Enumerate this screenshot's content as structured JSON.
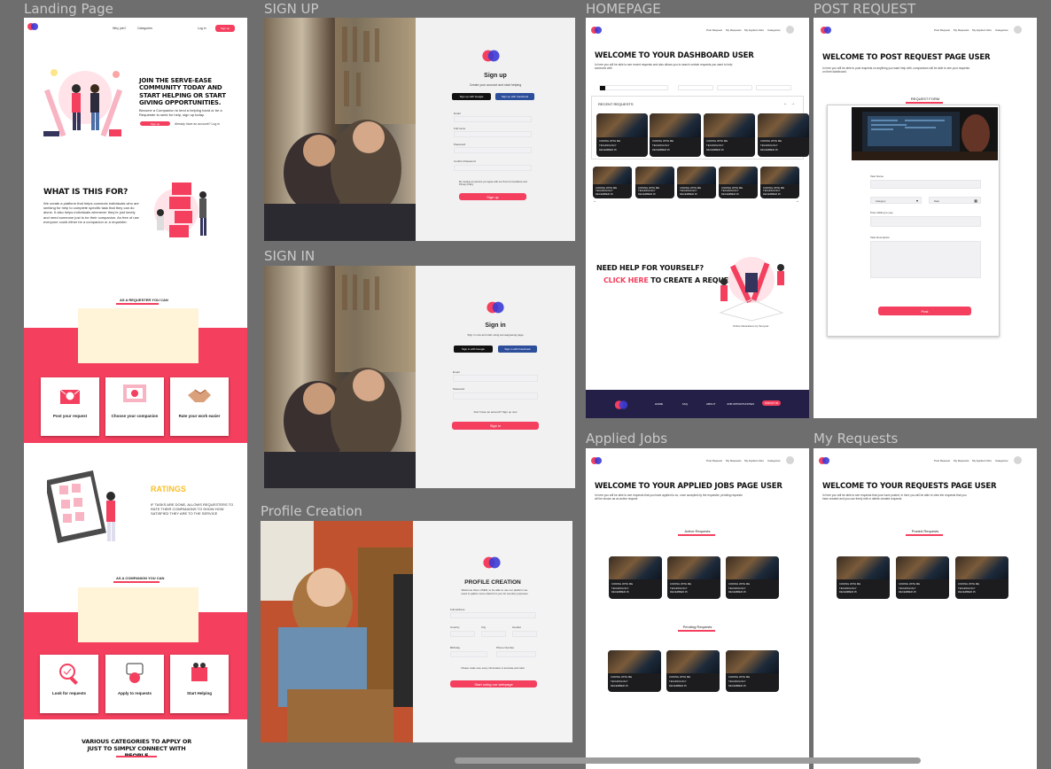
{
  "frames": {
    "landing": "Landing Page",
    "signup": "SIGN UP",
    "signin": "SIGN IN",
    "profile": "Profile Creation",
    "homepage": "HOMEPAGE",
    "post": "POST REQUEST",
    "applied": "Applied Jobs",
    "myreq": "My Requests"
  },
  "landing": {
    "nav": [
      "Why join?",
      "Categories",
      "Log in",
      "Sign up"
    ],
    "hero_title": "JOIN THE SERVE-EASE COMMUNITY TODAY AND START HELPING OR START GIVING OPPORTUNITIES.",
    "hero_sub": "Become a Companion to lend a helping hand or be a Requester to seek for help, sign up today.",
    "hero_btn": "Sign up",
    "hero_login": "Already have an account? Log in",
    "what_title": "WHAT IS THIS FOR?",
    "what_body": "We create a platform that helps connects individuals who are seeking for help to complete specific task that they can do alone. It also helps individuals whenever they're just lonely and need someone just to be their companion. As free of use everyone could either be a companion or a requester.",
    "req_heading": "AS A REQUESTER YOU CAN",
    "req_cards": [
      "Post your request",
      "Choose your companion",
      "Rate your work easier"
    ],
    "ratings_title": "RATINGS",
    "ratings_body": "IF TASKS ARE DONE, ALLOWS REQUESTERS TO RATE THEIR COMPANIONS TO SHOW HOW SATISFIED THEY ARE TO THE SERVICE",
    "comp_heading": "AS A COMPANION YOU CAN",
    "comp_cards": [
      "Look for requests",
      "Apply to requests",
      "Start Helping"
    ],
    "categories_title": "VARIOUS CATEGORIES TO APPLY OR JUST TO SIMPLY CONNECT WITH PEOPLE"
  },
  "signup": {
    "title": "Sign up",
    "sub": "Create your account and start helping",
    "google": "Sign up with Google",
    "facebook": "Sign up with Facebook",
    "fields": [
      "Email",
      "Full name",
      "Password",
      "Confirm Password"
    ],
    "terms": "By creating an account you agree with our Terms & Conditions and Privacy Policy",
    "btn": "Sign up"
  },
  "signin": {
    "title": "Sign in",
    "sub": "Sign in now and start using serveagreeing page",
    "google": "Sign in with Google",
    "facebook": "Sign in with Facebook",
    "fields": [
      "Email",
      "Password"
    ],
    "register": "Don't have an account? Sign up now",
    "btn": "Sign in"
  },
  "profile": {
    "title": "PROFILE CREATION",
    "sub": "Welcome there USER, to be able to use our platform we need to gather some data from you for security purposes",
    "fields": [
      "Full address",
      "Country",
      "City",
      "Gender",
      "Birthday",
      "Phone Number"
    ],
    "note": "Please make sure every information is accurate and valid",
    "btn": "Start using our webpage"
  },
  "home": {
    "nav": [
      "Post Request",
      "My Requests",
      "My Applied Jobs",
      "Categories"
    ],
    "title": "WELCOME TO YOUR DASHBOARD USER",
    "sub": "In here you will be able to see recent requests and also allows you to search certain requests you want to help someone with",
    "recent": "RECENT REQUESTS",
    "card_lines": [
      "CODING WITH ME",
      "TECHNOLOGY",
      "DECEMBER 15"
    ],
    "help_title_a": "NEED HELP FOR YOURSELF?",
    "help_title_b": "CLICK HERE",
    "help_title_c": "TO CREATE A REQUEST NOW",
    "caption": "Online illustrations by Storyset",
    "footer": [
      "HOME",
      "FAQ",
      "ABOUT",
      "JOB OPPORTUNITIES",
      "CONTACT US"
    ]
  },
  "post": {
    "title": "WELCOME TO POST REQUEST PAGE USER",
    "sub": "In here you will be able to post requests on anything you want help with, companions will be able to see your requests on their dashboard.",
    "form": "REQUEST FORM",
    "fields": [
      "Task Name",
      "Category",
      "Date",
      "Price Willing to pay",
      "Task Description"
    ],
    "btn": "Post"
  },
  "applied": {
    "title": "WELCOME TO YOUR APPLIED JOBS PAGE USER",
    "sub": "In here you will be able to see requests that you have applied to so, once accepted by the requester, pending requests will be shown as an active request",
    "active": "Active Requests",
    "pending": "Pending Requests"
  },
  "myreq": {
    "title": "WELCOME TO YOUR REQUESTS PAGE USER",
    "sub": "In here you will be able to see requests that your have posted, in here you will be able to view the requests that you have created and you can freely edit or delete created requests",
    "posted": "Posted Requests"
  }
}
